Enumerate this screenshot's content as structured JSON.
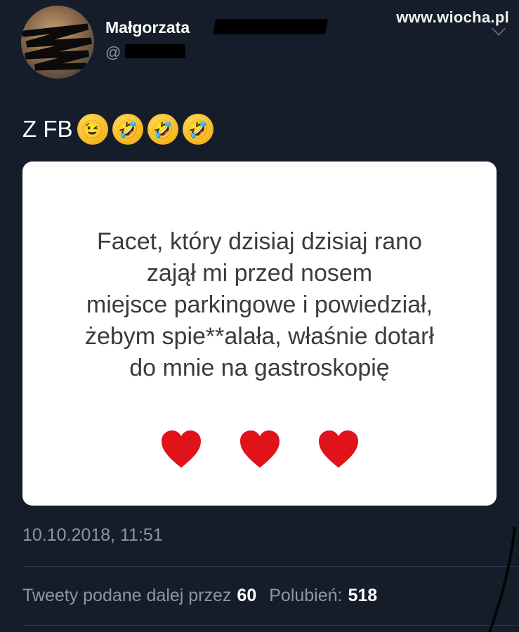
{
  "header": {
    "display_name": "Małgorzata",
    "handle": "@",
    "watermark": "www.wiocha.pl"
  },
  "tweet": {
    "text": "Z FB",
    "emojis": [
      "winking-face",
      "rolling-on-floor-laughing",
      "rolling-on-floor-laughing",
      "rolling-on-floor-laughing"
    ]
  },
  "card": {
    "text": "Facet, który dzisiaj dzisiaj rano\nzajął mi przed nosem\nmiejsce parkingowe i powiedział,\nżebym spie**alała, właśnie dotarł\ndo mnie na gastroskopię",
    "heart_color": "#e0121a",
    "heart_count": 3
  },
  "meta": {
    "timestamp": "10.10.2018, 11:51"
  },
  "stats": {
    "retweets_label": "Tweety podane dalej przez",
    "retweets": "60",
    "likes_label": "Polubień:",
    "likes": "518"
  },
  "colors": {
    "background": "#161d2a",
    "muted_text": "#8a96a6"
  }
}
